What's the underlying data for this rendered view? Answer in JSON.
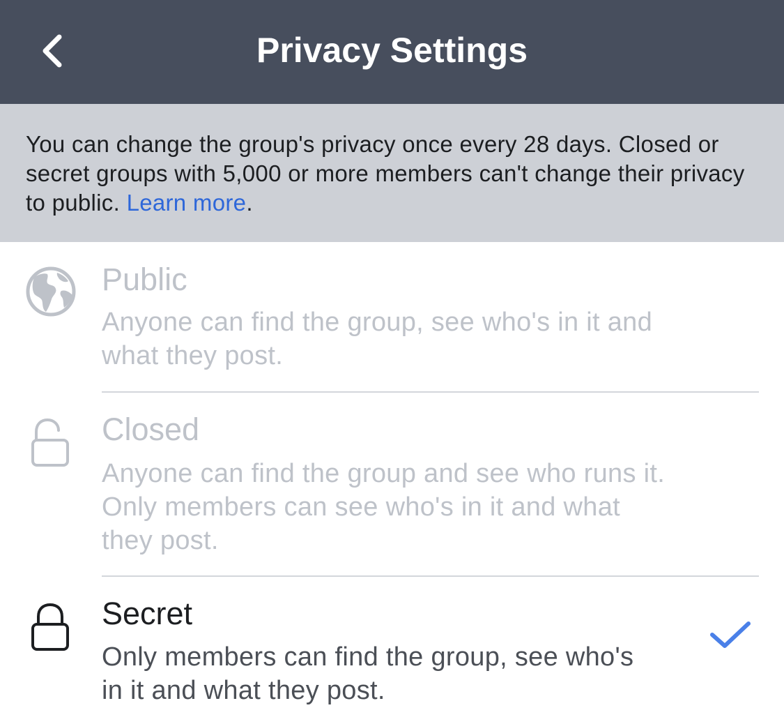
{
  "header": {
    "title": "Privacy Settings",
    "back_icon": "chevron-left-icon"
  },
  "notice": {
    "text": "You can change the group's privacy once every 28 days. Closed or secret groups with 5,000 or more members can't change their privacy to public. ",
    "link_label": "Learn more",
    "trailing": "."
  },
  "options": [
    {
      "icon": "globe-icon",
      "title": "Public",
      "description": "Anyone can find the group, see who's in it and what they post.",
      "enabled": false,
      "selected": false
    },
    {
      "icon": "unlocked-padlock-icon",
      "title": "Closed",
      "description": "Anyone can find the group and see who runs it. Only members can see who's in it and what they post.",
      "enabled": false,
      "selected": false
    },
    {
      "icon": "locked-padlock-icon",
      "title": "Secret",
      "description": "Only members can find the group, see who's in it and what they post.",
      "enabled": true,
      "selected": true
    }
  ],
  "colors": {
    "header_bg": "#474e5d",
    "notice_bg": "#cdd0d6",
    "link": "#2e67d9",
    "check": "#4a80e8",
    "disabled_text": "#bec2c9"
  }
}
